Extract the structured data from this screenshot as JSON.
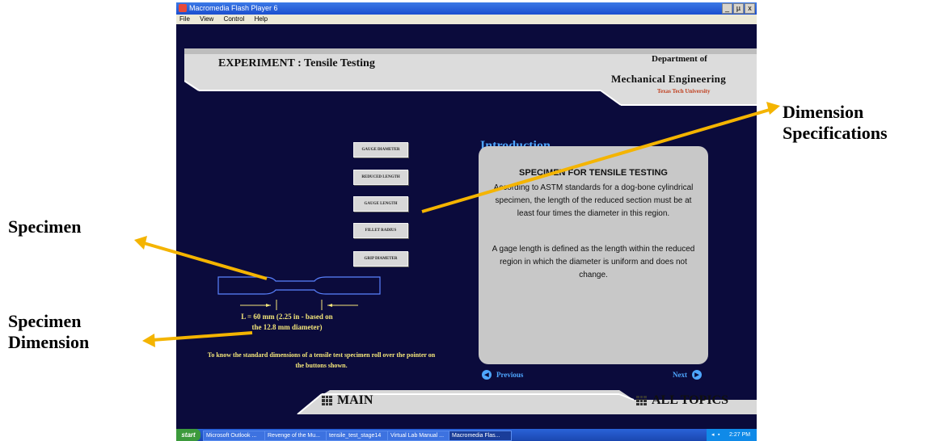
{
  "window": {
    "title": "Macromedia Flash Player 6",
    "menu": [
      "File",
      "View",
      "Control",
      "Help"
    ],
    "controls": [
      "_",
      "µ",
      "x"
    ]
  },
  "header": {
    "experiment_title": "EXPERIMENT : Tensile Testing",
    "dept_line1": "Department of",
    "dept_line2": "Mechanical Engineering",
    "dept_line3": "Texas Tech University"
  },
  "dimension_buttons": [
    {
      "label": "GAUGE DIAMETER"
    },
    {
      "label": "REDUCED LENGTH"
    },
    {
      "label": "GAUGE LENGTH"
    },
    {
      "label": "FILLET RADIUS"
    },
    {
      "label": "GRIP DIAMETER"
    }
  ],
  "specimen": {
    "length_text": "L = 60 mm (2.25 in - based on the 12.8 mm diameter)",
    "hint": "To know the  standard dimensions of a tensile test specimen roll over the pointer on the buttons shown."
  },
  "intro": {
    "heading": "Introduction",
    "box_title": "SPECIMEN FOR TENSILE TESTING",
    "para1": "According to ASTM standards for a dog-bone cylindrical specimen, the length of the reduced section must be at least four times the diameter in this region.",
    "para2": "A gage length is defined as the length within the reduced region in which the diameter is uniform and does not change."
  },
  "nav": {
    "previous": "Previous",
    "next": "Next",
    "main": "MAIN",
    "all_topics": "ALL TOPICS"
  },
  "taskbar": {
    "start": "start",
    "items": [
      "Microsoft Outlook ...",
      "Revenge of the Mu...",
      "tensile_test_stage14",
      "Virtual Lab Manual ...",
      "Macromedia Flas..."
    ],
    "active_index": 4,
    "clock": "2:27 PM"
  },
  "annotations": {
    "dimension_specs": [
      "Dimension",
      "Specifications"
    ],
    "specimen": "Specimen",
    "specimen_dimension": [
      "Specimen",
      "Dimension"
    ]
  },
  "colors": {
    "background": "#0b0b3c",
    "accent_blue": "#4ea6ff",
    "yellow_text": "#f4e67a",
    "arrow": "#f4b400"
  }
}
